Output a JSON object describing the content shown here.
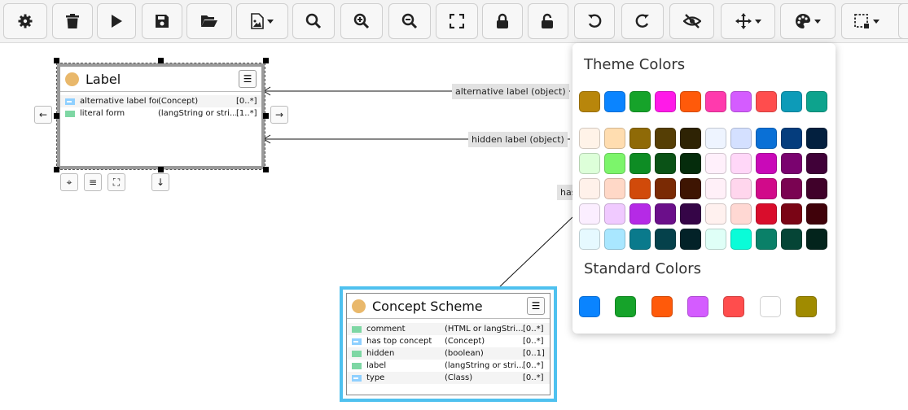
{
  "toolbar": {
    "buttons": [
      {
        "name": "settings-button",
        "icon": "gear-icon"
      },
      {
        "name": "delete-button",
        "icon": "trash-icon"
      },
      {
        "name": "play-button",
        "icon": "play-icon"
      },
      {
        "name": "save-button",
        "icon": "floppy-disk-icon"
      },
      {
        "name": "open-folder-button",
        "icon": "folder-open-icon"
      },
      {
        "name": "export-image-button",
        "icon": "file-image-icon"
      },
      {
        "name": "search-button",
        "icon": "search-icon"
      },
      {
        "name": "zoom-in-button",
        "icon": "zoom-in-icon"
      },
      {
        "name": "zoom-out-button",
        "icon": "zoom-out-icon"
      },
      {
        "name": "fit-screen-button",
        "icon": "expand-icon"
      },
      {
        "name": "lock-button",
        "icon": "lock-icon"
      },
      {
        "name": "unlock-button",
        "icon": "unlock-icon"
      },
      {
        "name": "undo-button",
        "icon": "undo-icon"
      },
      {
        "name": "redo-button",
        "icon": "redo-icon"
      },
      {
        "name": "hide-button",
        "icon": "eye-slash-icon"
      },
      {
        "name": "move-button",
        "icon": "move-arrows-icon"
      },
      {
        "name": "color-palette-button",
        "icon": "palette-icon"
      },
      {
        "name": "layout-button",
        "icon": "select-area-icon"
      }
    ]
  },
  "edges": {
    "alt_label": "alternative label (object)",
    "hidden_label": "hidden label (object)",
    "has_partial": "has"
  },
  "label_node": {
    "title": "Label",
    "rows": [
      {
        "kind": "obj",
        "name": "alternative label for",
        "type": "(Concept)",
        "card": "[0..*]"
      },
      {
        "kind": "lit",
        "name": "literal form",
        "type": "(langString or stri...",
        "card": "[1..*]"
      }
    ]
  },
  "scheme_node": {
    "title": "Concept Scheme",
    "rows": [
      {
        "kind": "lit",
        "name": "comment",
        "type": "(HTML or langStri...",
        "card": "[0..*]"
      },
      {
        "kind": "obj",
        "name": "has top concept",
        "type": "(Concept)",
        "card": "[0..*]"
      },
      {
        "kind": "lit",
        "name": "hidden",
        "type": "(boolean)",
        "card": "[0..1]"
      },
      {
        "kind": "lit",
        "name": "label",
        "type": "(langString or stri...",
        "card": "[0..*]"
      },
      {
        "kind": "obj",
        "name": "type",
        "type": "(Class)",
        "card": "[0..*]"
      }
    ]
  },
  "color_popup": {
    "theme_title": "Theme Colors",
    "standard_title": "Standard Colors",
    "theme_top": [
      "#b8860b",
      "#0a84ff",
      "#16a32a",
      "#ff1ae8",
      "#ff5a0a",
      "#ff3aad",
      "#d45cff",
      "#ff4d4d",
      "#0d9bb8",
      "#0da38d"
    ],
    "theme_grid": [
      [
        "#fff3e8",
        "#ffddb0",
        "#8f6a07",
        "#553e05",
        "#2e2304",
        "#eef4ff",
        "#d4e0ff",
        "#0a70d6",
        "#053d7d",
        "#03203f"
      ],
      [
        "#ddffd9",
        "#7cf56b",
        "#0e8c24",
        "#0a5216",
        "#052c0c",
        "#fff0fb",
        "#ffd7f8",
        "#c909b8",
        "#7a036f",
        "#400138"
      ],
      [
        "#fff1ea",
        "#ffd8c7",
        "#d14a0a",
        "#7a2a04",
        "#3e1502",
        "#fff0f8",
        "#ffd6ed",
        "#d10a8a",
        "#7a0352",
        "#40012a"
      ],
      [
        "#fbeeff",
        "#f0caff",
        "#b52ae6",
        "#6b0f8a",
        "#350547",
        "#fff1ef",
        "#ffd8d3",
        "#d90d2c",
        "#7a0515",
        "#40020a"
      ],
      [
        "#e6f9ff",
        "#a9e7ff",
        "#0a7a8c",
        "#05414b",
        "#032228",
        "#dffff7",
        "#0afcd8",
        "#0a8068",
        "#054536",
        "#03241c"
      ]
    ],
    "standard": [
      "#0a84ff",
      "#16a32a",
      "#ff5a0a",
      "#d45cff",
      "#ff4d4d",
      "#ffffff",
      "#a08b00"
    ]
  }
}
